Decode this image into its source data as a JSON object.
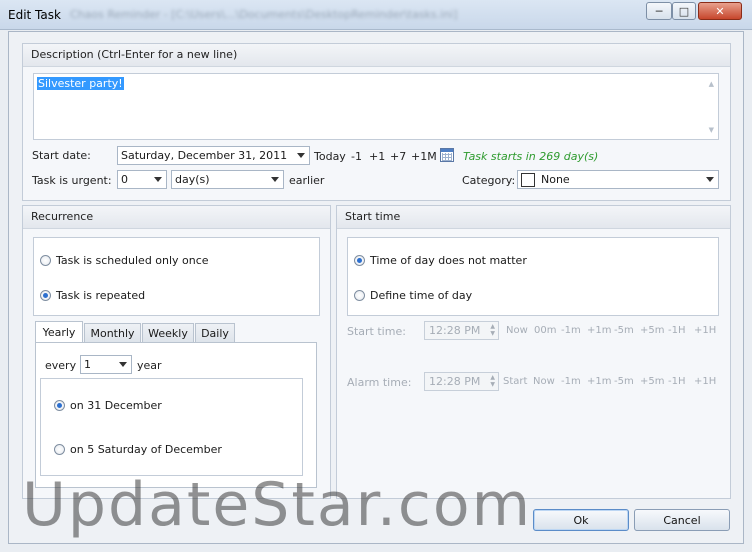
{
  "window": {
    "title": "Edit Task",
    "path_blurred": "Chaos Reminder - [C:\\Users\\...\\Documents\\DesktopReminder\\tasks.ini]",
    "controls": {
      "minimize": "─",
      "maximize": "□",
      "close": "✕"
    }
  },
  "description": {
    "header": "Description (Ctrl-Enter for a new line)",
    "text": "Silvester party!"
  },
  "start": {
    "label": "Start date:",
    "date": "Saturday, December 31, 2011",
    "quick": [
      "Today",
      "-1",
      "+1",
      "+7",
      "+1M"
    ],
    "status": "Task starts in 269 day(s)",
    "status_color": "#2e9b2e"
  },
  "urgent": {
    "label": "Task is urgent:",
    "value": "0",
    "unit": "day(s)",
    "suffix": "earlier"
  },
  "category": {
    "label": "Category:",
    "value": "None"
  },
  "recurrence": {
    "header": "Recurrence",
    "once": "Task is scheduled only once",
    "repeated": "Task is repeated",
    "tabs": [
      "Yearly",
      "Monthly",
      "Weekly",
      "Daily"
    ],
    "every_label": "every",
    "every_value": "1",
    "every_unit": "year",
    "opt1": "on 31 December",
    "opt2": "on 5 Saturday of December"
  },
  "starttime": {
    "header": "Start time",
    "not_matter": "Time of day does not matter",
    "define": "Define time of day",
    "start_label": "Start time:",
    "start_value": "12:28 PM",
    "start_quick": [
      "Now",
      "00m",
      "-1m",
      "+1m",
      "-5m",
      "+5m",
      "-1H",
      "+1H"
    ],
    "alarm_label": "Alarm time:",
    "alarm_value": "12:28 PM",
    "alarm_quick": [
      "Start",
      "Now",
      "-1m",
      "+1m",
      "-5m",
      "+5m",
      "-1H",
      "+1H"
    ]
  },
  "buttons": {
    "ok": "Ok",
    "cancel": "Cancel"
  },
  "watermark": "UpdateStar.com",
  "colors": {
    "accent": "#2c6fcf",
    "selection": "#3399ff"
  }
}
